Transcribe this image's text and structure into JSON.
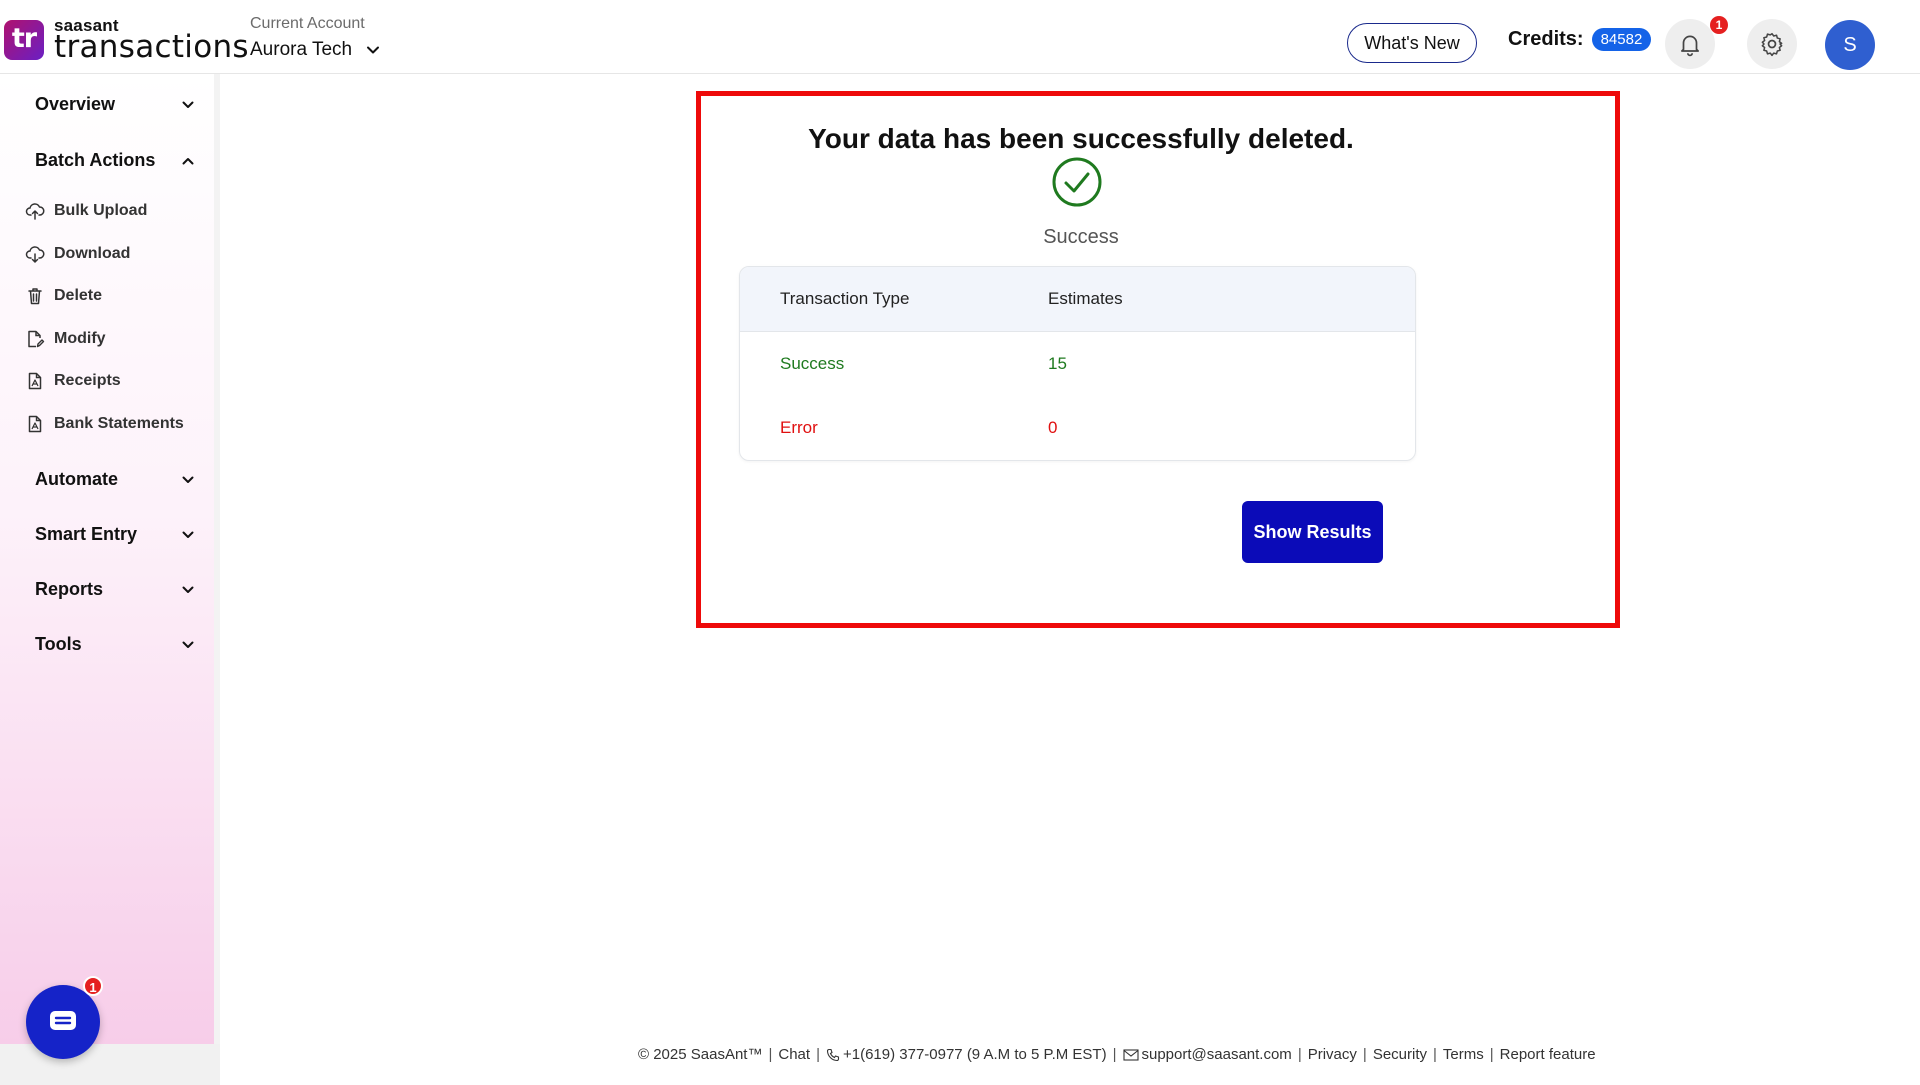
{
  "header": {
    "logo_mark": "tr",
    "logo_small": "saasant",
    "logo_big": "transactions",
    "account_label": "Current Account",
    "account_name": "Aurora Tech",
    "whats_new_label": "What's New",
    "credits_label": "Credits:",
    "credits_value": "84582",
    "notification_count": "1",
    "avatar_initial": "S"
  },
  "sidebar": {
    "sections": {
      "overview": "Overview",
      "batch_actions": "Batch Actions",
      "automate": "Automate",
      "smart_entry": "Smart Entry",
      "reports": "Reports",
      "tools": "Tools"
    },
    "batch_items": {
      "bulk_upload": "Bulk Upload",
      "download": "Download",
      "delete": "Delete",
      "modify": "Modify",
      "receipts": "Receipts",
      "bank_statements": "Bank Statements"
    },
    "chat_badge": "1"
  },
  "main": {
    "title": "Your data has been successfully deleted.",
    "status": "Success",
    "table": {
      "headers": [
        "Transaction Type",
        "Estimates"
      ],
      "rows": [
        {
          "type": "Success",
          "value": "15"
        },
        {
          "type": "Error",
          "value": "0"
        }
      ]
    },
    "show_results_label": "Show Results"
  },
  "footer": {
    "copyright": "© 2025 SaasAnt™",
    "chat": "Chat",
    "phone": "+1(619) 377-0977 (9 A.M to 5 P.M EST)",
    "email": "support@saasant.com",
    "privacy": "Privacy",
    "security": "Security",
    "terms": "Terms",
    "report_feature": "Report feature"
  },
  "colors": {
    "accent_blue": "#0b0bb8",
    "credits_badge": "#1463e8",
    "highlight_frame": "#ee0a0a",
    "success_green": "#1f7a1f",
    "error_red": "#e01010"
  }
}
